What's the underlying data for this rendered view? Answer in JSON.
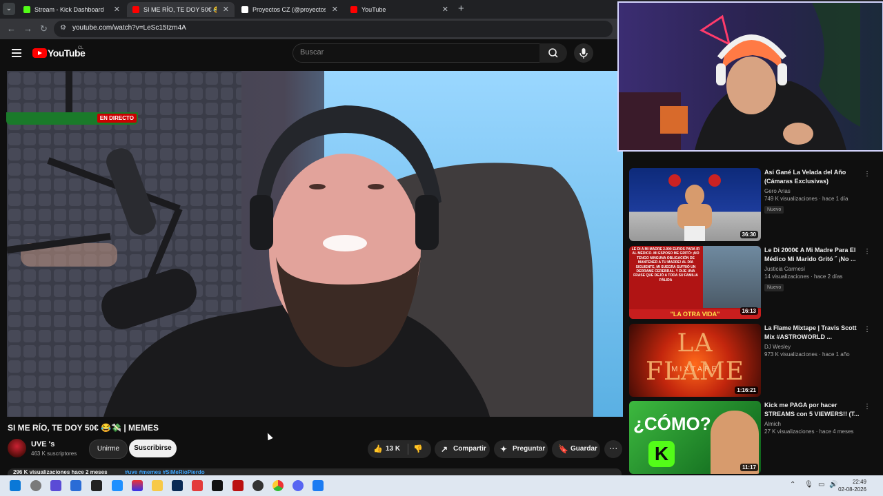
{
  "browser": {
    "tabs": [
      {
        "title": "Stream - Kick Dashboard",
        "favicon_color": "#53fc18",
        "active": false
      },
      {
        "title": "SI ME RÍO, TE DOY 50€ 😂💸",
        "favicon_color": "#ff0000",
        "active": true
      },
      {
        "title": "Proyectos CZ (@proyectos.cz) |",
        "favicon_color": "#ffffff",
        "active": false
      },
      {
        "title": "YouTube",
        "favicon_color": "#ff0000",
        "active": false
      }
    ],
    "close_glyph": "✕",
    "new_tab_glyph": "+",
    "url": "youtube.com/watch?v=LeSc15tzm4A"
  },
  "youtube": {
    "logo_text": "YouTube",
    "region": "CL",
    "search_placeholder": "Buscar"
  },
  "video": {
    "title": "SI ME RÍO, TE DOY 50€ 😂💸 | MEMES",
    "channel_name": "UVE 's",
    "subscribers": "463 K suscriptores",
    "join_label": "Unirme",
    "subscribe_label": "Suscribirse",
    "likes": "13 K",
    "share_label": "Compartir",
    "ask_label": "Preguntar",
    "save_label": "Guardar",
    "description_stats": "296 K visualizaciones  hace 2 meses",
    "description_tags": "#uve #memes #SiMeRioPierdo"
  },
  "sidebar": {
    "live_label": "EN DIRECTO",
    "items": [
      {
        "title": "Así Gané La Velada del Año (Cámaras Exclusivas)",
        "channel": "Gero Arias",
        "meta": "749 K visualizaciones · hace 1 día",
        "badge": "Nuevo",
        "duration": "36:30"
      },
      {
        "title": "Le Di 2000€ A Mi Madre Para El Médico Mi Marido Gritó ˝ ¡No ...",
        "channel": "Justicia Carmesí",
        "meta": "14 visualizaciones · hace 2 días",
        "badge": "Nuevo",
        "duration": "16:13",
        "thumb_caption": "\"LA OTRA VIDA\"",
        "thumb_text": "LE DI A MI MADRE 2.000 EUROS PARA IR AL MÉDICO. MI ESPOSO ME GRITÓ: ¡NO TENGO NINGUNA OBLIGACIÓN DE MANTENER A TU MADRE! AL DÍA SIGUIENTE, MI SUEGRA SUFRIÓ UN DERRAME CEREBRAL. Y DIJE UNA FRASE QUE DEJÓ A TODA SU FAMILIA PÁLIDA"
      },
      {
        "title": "La Flame Mixtape | Travis Scott Mix #ASTROWORLD ...",
        "channel": "DJ Wesley",
        "meta": "973 K visualizaciones · hace 1 año",
        "badge": "",
        "duration": "1:16:21",
        "thumb_text": "LA FLAME",
        "thumb_sub": "MIXTAPE"
      },
      {
        "title": "Kick me PAGA por hacer STREAMS con 5 VIEWERS!! (T...",
        "channel": "Almich",
        "meta": "27 K visualizaciones · hace 4 meses",
        "badge": "",
        "duration": "11:17",
        "thumb_text": "¿CÓMO?"
      }
    ]
  },
  "taskbar": {
    "time": "22:49",
    "date": "02-08-2026"
  },
  "colors": {
    "yt_red": "#ff0000",
    "kick_green": "#53fc18",
    "bg": "#0f0f0f"
  }
}
